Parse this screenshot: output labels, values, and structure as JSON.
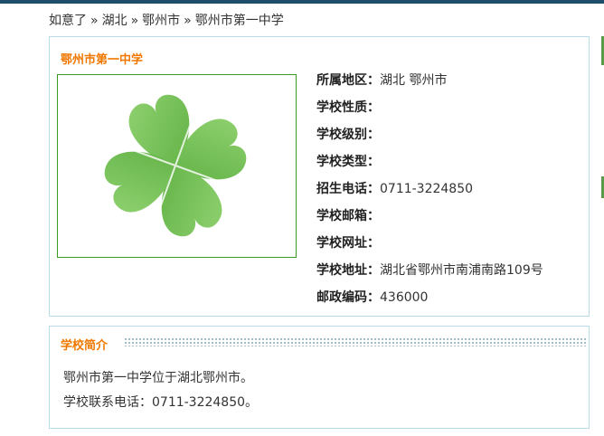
{
  "breadcrumb": {
    "items": [
      "如意了",
      "湖北",
      "鄂州市",
      "鄂州市第一中学"
    ],
    "separator": "»"
  },
  "school": {
    "name": "鄂州市第一中学",
    "fields": [
      {
        "label": "所属地区：",
        "value": "湖北 鄂州市"
      },
      {
        "label": "学校性质：",
        "value": ""
      },
      {
        "label": "学校级别：",
        "value": ""
      },
      {
        "label": "学校类型：",
        "value": ""
      },
      {
        "label": "招生电话：",
        "value": "0711-3224850"
      },
      {
        "label": "学校邮箱：",
        "value": ""
      },
      {
        "label": "学校网址：",
        "value": ""
      },
      {
        "label": "学校地址：",
        "value": "湖北省鄂州市南浦南路109号"
      },
      {
        "label": "邮政编码：",
        "value": "436000"
      }
    ],
    "photo_icon": "four-leaf-clover-icon"
  },
  "intro": {
    "title": "学校简介",
    "lines": [
      "鄂州市第一中学位于湖北鄂州市。",
      "学校联系电话：0711-3224850。"
    ]
  },
  "colors": {
    "accent": "#f07800",
    "border": "#b8dce8",
    "clover": "#6cbf4f"
  }
}
